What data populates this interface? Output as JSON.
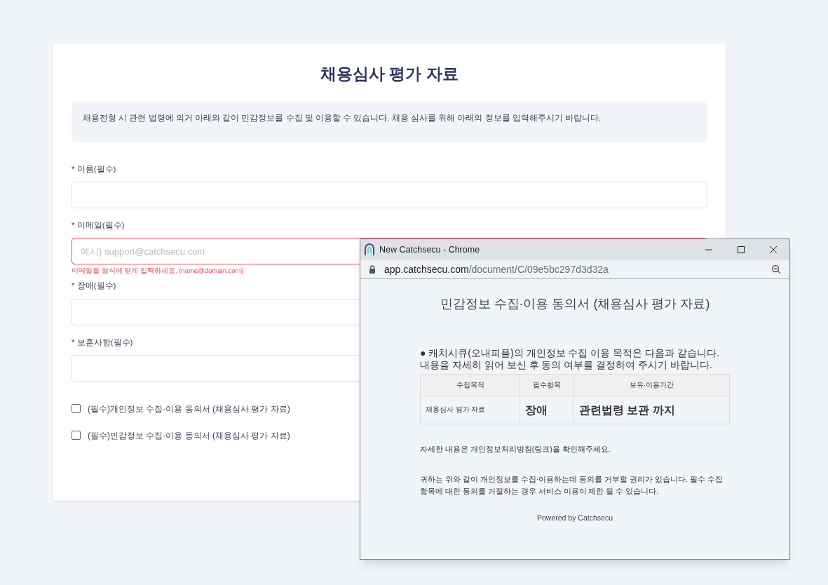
{
  "form": {
    "title": "채용심사 평가 자료",
    "notice": "채용전형 시 관련 법령에 의거 아래와 같이 민감정보를 수집 및 이용할 수 있습니다. 채용 심사를 위해 아래의 정보를 입력해주시기 바랍니다.",
    "fields": [
      {
        "label": "* 이름(필수)",
        "invalid": false
      },
      {
        "label": "* 이메일(필수)",
        "placeholder": "예시) support@catchsecu.com",
        "invalid": true,
        "error": "이메일을 형식에 맞게 입력하세요. (name@domain.com)"
      },
      {
        "label": "* 장애(필수)",
        "invalid": false
      },
      {
        "label": "* 보훈사항(필수)",
        "invalid": false
      }
    ],
    "consents": [
      {
        "label": "(필수)개인정보 수집·이용 동의서 (채용심사 평가 자료)",
        "checked": false
      },
      {
        "label": "(필수)민감정보 수집·이용 동의서 (채용심사 평가 자료)",
        "checked": false
      }
    ]
  },
  "popup": {
    "window_title": "New Catchsecu - Chrome",
    "url_host": "app.catchsecu.com",
    "url_path": "/document/C/09e5bc297d3d32a",
    "heading": "민감정보 수집·이용 동의서 (채용심사 평가 자료)",
    "intro": "● 캐치시큐(오내피플)의 개인정보 수집 이용 목적은 다음과 같습니다. 내용을 자세히 읽어 보신 후 동의 여부를 결정하여 주시기 바랍니다.",
    "table": {
      "columns": [
        "수집목적",
        "필수항목",
        "보유·이용기간"
      ],
      "rows": [
        [
          "채용심사 평가 자료",
          "장애",
          "관련법령 보관 까지"
        ]
      ]
    },
    "details": "자세한 내용은 개인정보처리방침(링크)을 확인해주세요.",
    "rights": "귀하는 위와 같이 개인정보를 수집·이용하는데 동의를 거부할 권리가 있습니다. 필수 수집 항목에 대한 동의를 거절하는 경우 서비스 이용이 제한 될 수 있습니다.",
    "footer": "Powered by Catchsecu"
  }
}
